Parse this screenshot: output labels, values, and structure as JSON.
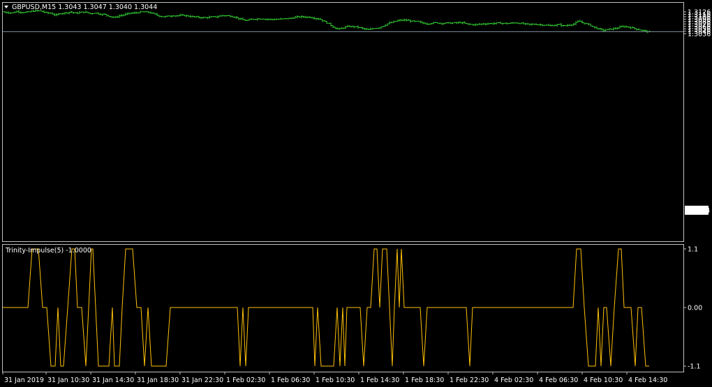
{
  "colors": {
    "background": "#000000",
    "frame": "#c0c0c0",
    "bars": "#32cd32",
    "bid_line": "#778899",
    "indicator": "#ffc107",
    "text": "#ffffff"
  },
  "main": {
    "title": "GBPUSD,M15  1.3043 1.3047 1.3040 1.3044",
    "current_price_label": "1.3044"
  },
  "sub": {
    "title": "Trinity-Impulse(5) -1.0000"
  },
  "chart_data": [
    {
      "type": "ohlc",
      "symbol": "GBPUSD",
      "timeframe": "M15",
      "ylim": [
        1.3031,
        1.3131
      ],
      "y_ticks": [
        "1.3126",
        "1.3116",
        "1.3106",
        "1.3096",
        "1.3086",
        "1.3076",
        "1.3066",
        "1.3056",
        "1.3046",
        "1.3036"
      ],
      "current_price": 1.3044,
      "close_path": [
        [
          0,
          1.3126
        ],
        [
          7,
          1.3123
        ],
        [
          14,
          1.3122
        ],
        [
          20,
          1.3128
        ],
        [
          27,
          1.3124
        ],
        [
          34,
          1.3124
        ],
        [
          41,
          1.3128
        ],
        [
          48,
          1.3131
        ],
        [
          55,
          1.3129
        ],
        [
          62,
          1.3122
        ],
        [
          69,
          1.312
        ],
        [
          76,
          1.3112
        ],
        [
          83,
          1.312
        ],
        [
          90,
          1.3122
        ],
        [
          97,
          1.3126
        ],
        [
          104,
          1.312
        ],
        [
          111,
          1.3124
        ],
        [
          118,
          1.3125
        ],
        [
          125,
          1.3119
        ],
        [
          132,
          1.3122
        ],
        [
          139,
          1.3117
        ],
        [
          146,
          1.3115
        ],
        [
          153,
          1.3108
        ],
        [
          160,
          1.3102
        ],
        [
          167,
          1.311
        ],
        [
          174,
          1.3114
        ],
        [
          181,
          1.312
        ],
        [
          188,
          1.3121
        ],
        [
          195,
          1.3124
        ],
        [
          202,
          1.3126
        ],
        [
          209,
          1.3124
        ],
        [
          216,
          1.3118
        ],
        [
          223,
          1.311
        ],
        [
          230,
          1.3106
        ],
        [
          237,
          1.3108
        ],
        [
          244,
          1.3111
        ],
        [
          251,
          1.311
        ],
        [
          258,
          1.3112
        ],
        [
          265,
          1.3109
        ],
        [
          272,
          1.3106
        ],
        [
          279,
          1.3104
        ],
        [
          286,
          1.3102
        ],
        [
          293,
          1.3103
        ],
        [
          300,
          1.3105
        ],
        [
          307,
          1.3106
        ],
        [
          314,
          1.3111
        ],
        [
          321,
          1.311
        ],
        [
          328,
          1.3108
        ],
        [
          335,
          1.3102
        ],
        [
          342,
          1.3094
        ],
        [
          349,
          1.309
        ],
        [
          356,
          1.3095
        ],
        [
          363,
          1.3097
        ],
        [
          370,
          1.3098
        ],
        [
          377,
          1.3096
        ],
        [
          384,
          1.3095
        ],
        [
          391,
          1.3095
        ],
        [
          398,
          1.3096
        ],
        [
          405,
          1.3098
        ],
        [
          412,
          1.3099
        ],
        [
          419,
          1.3104
        ],
        [
          426,
          1.3106
        ],
        [
          433,
          1.3105
        ],
        [
          440,
          1.3104
        ],
        [
          447,
          1.31
        ],
        [
          454,
          1.3096
        ],
        [
          461,
          1.3086
        ],
        [
          468,
          1.3075
        ],
        [
          475,
          1.306
        ],
        [
          482,
          1.3055
        ],
        [
          489,
          1.3062
        ],
        [
          496,
          1.3066
        ],
        [
          503,
          1.3065
        ],
        [
          510,
          1.3062
        ],
        [
          517,
          1.3056
        ],
        [
          524,
          1.3052
        ],
        [
          531,
          1.3058
        ],
        [
          538,
          1.306
        ],
        [
          545,
          1.3068
        ],
        [
          552,
          1.3078
        ],
        [
          559,
          1.3084
        ],
        [
          566,
          1.309
        ],
        [
          573,
          1.3092
        ],
        [
          580,
          1.3091
        ],
        [
          587,
          1.3087
        ],
        [
          594,
          1.3086
        ],
        [
          601,
          1.308
        ],
        [
          608,
          1.3077
        ],
        [
          615,
          1.308
        ],
        [
          622,
          1.3081
        ],
        [
          629,
          1.3079
        ],
        [
          636,
          1.308
        ],
        [
          643,
          1.308
        ],
        [
          650,
          1.3081
        ],
        [
          657,
          1.3082
        ],
        [
          664,
          1.3076
        ],
        [
          671,
          1.3074
        ],
        [
          678,
          1.3073
        ],
        [
          685,
          1.3076
        ],
        [
          692,
          1.3077
        ],
        [
          699,
          1.3078
        ],
        [
          706,
          1.3079
        ],
        [
          713,
          1.308
        ],
        [
          720,
          1.3078
        ],
        [
          727,
          1.3079
        ],
        [
          734,
          1.3081
        ],
        [
          741,
          1.3079
        ],
        [
          748,
          1.3076
        ],
        [
          755,
          1.3074
        ],
        [
          762,
          1.3075
        ],
        [
          769,
          1.3073
        ],
        [
          776,
          1.3072
        ],
        [
          783,
          1.3069
        ],
        [
          790,
          1.3071
        ],
        [
          797,
          1.3073
        ],
        [
          804,
          1.3068
        ],
        [
          811,
          1.3072
        ],
        [
          818,
          1.3076
        ],
        [
          825,
          1.3088
        ],
        [
          832,
          1.308
        ],
        [
          839,
          1.3074
        ],
        [
          846,
          1.3064
        ],
        [
          853,
          1.3056
        ],
        [
          860,
          1.305
        ],
        [
          867,
          1.3053
        ],
        [
          874,
          1.3056
        ],
        [
          881,
          1.306
        ],
        [
          888,
          1.3066
        ],
        [
          895,
          1.3064
        ],
        [
          902,
          1.306
        ],
        [
          909,
          1.3054
        ],
        [
          916,
          1.305
        ],
        [
          923,
          1.3045
        ],
        [
          928,
          1.3044
        ]
      ]
    },
    {
      "type": "line",
      "name": "Trinity-Impulse(5)",
      "ylim": [
        -1.1,
        1.1
      ],
      "y_ticks": [
        "1.1",
        "0.00",
        "-1.1"
      ],
      "last_value": -1.0,
      "x_labels": [
        "31 Jan 2019",
        "31 Jan 10:30",
        "31 Jan 14:30",
        "31 Jan 18:30",
        "31 Jan 22:30",
        "1 Feb 02:30",
        "1 Feb 06:30",
        "1 Feb 10:30",
        "1 Feb 14:30",
        "1 Feb 18:30",
        "1 Feb 22:30",
        "4 Feb 02:30",
        "4 Feb 06:30",
        "4 Feb 10:30",
        "4 Feb 14:30"
      ],
      "points": [
        [
          0,
          0
        ],
        [
          36,
          0
        ],
        [
          42,
          1.1
        ],
        [
          51,
          1.1
        ],
        [
          57,
          0
        ],
        [
          63,
          0
        ],
        [
          69,
          -1.1
        ],
        [
          75,
          -1.1
        ],
        [
          79,
          0
        ],
        [
          83,
          -1.1
        ],
        [
          87,
          -1.1
        ],
        [
          93,
          0
        ],
        [
          99,
          1.1
        ],
        [
          103,
          1.1
        ],
        [
          107,
          0
        ],
        [
          113,
          0
        ],
        [
          119,
          -1.1
        ],
        [
          123,
          0
        ],
        [
          127,
          1.1
        ],
        [
          129,
          1.1
        ],
        [
          133,
          0
        ],
        [
          137,
          -1.1
        ],
        [
          152,
          -1.1
        ],
        [
          157,
          0
        ],
        [
          160,
          -1.1
        ],
        [
          167,
          -1.1
        ],
        [
          171,
          0
        ],
        [
          176,
          1.1
        ],
        [
          186,
          1.1
        ],
        [
          192,
          0
        ],
        [
          198,
          0
        ],
        [
          203,
          -1.1
        ],
        [
          208,
          0
        ],
        [
          213,
          -1.1
        ],
        [
          217,
          -1.1
        ],
        [
          220,
          -1.1
        ],
        [
          234,
          -1.1
        ],
        [
          240,
          0
        ],
        [
          336,
          0
        ],
        [
          340,
          -1.1
        ],
        [
          344,
          0
        ],
        [
          348,
          -1.1
        ],
        [
          352,
          0
        ],
        [
          444,
          0
        ],
        [
          447,
          -1.1
        ],
        [
          451,
          0
        ],
        [
          456,
          -1.1
        ],
        [
          474,
          -1.1
        ],
        [
          479,
          0
        ],
        [
          483,
          -1.1
        ],
        [
          487,
          0
        ],
        [
          490,
          -1.1
        ],
        [
          493,
          0
        ],
        [
          512,
          0
        ],
        [
          517,
          -1.1
        ],
        [
          522,
          0
        ],
        [
          527,
          0
        ],
        [
          532,
          1.1
        ],
        [
          536,
          1.1
        ],
        [
          540,
          0
        ],
        [
          544,
          1.1
        ],
        [
          550,
          1.1
        ],
        [
          554,
          0
        ],
        [
          558,
          -1.1
        ],
        [
          561,
          0
        ],
        [
          565,
          1.1
        ],
        [
          568,
          0
        ],
        [
          571,
          1.1
        ],
        [
          575,
          0
        ],
        [
          598,
          0
        ],
        [
          603,
          -1.1
        ],
        [
          608,
          0
        ],
        [
          664,
          0
        ],
        [
          669,
          -1.1
        ],
        [
          673,
          0
        ],
        [
          817,
          0
        ],
        [
          822,
          1.1
        ],
        [
          828,
          1.1
        ],
        [
          833,
          0
        ],
        [
          839,
          -1.1
        ],
        [
          849,
          -1.1
        ],
        [
          853,
          0
        ],
        [
          857,
          -1.1
        ],
        [
          861,
          0
        ],
        [
          865,
          0
        ],
        [
          871,
          -1.1
        ],
        [
          876,
          0
        ],
        [
          882,
          1.1
        ],
        [
          886,
          1.1
        ],
        [
          890,
          0
        ],
        [
          896,
          0
        ],
        [
          900,
          0
        ],
        [
          906,
          -1.1
        ],
        [
          910,
          0
        ],
        [
          915,
          0
        ],
        [
          921,
          -1.1
        ],
        [
          926,
          -1.1
        ]
      ]
    }
  ]
}
